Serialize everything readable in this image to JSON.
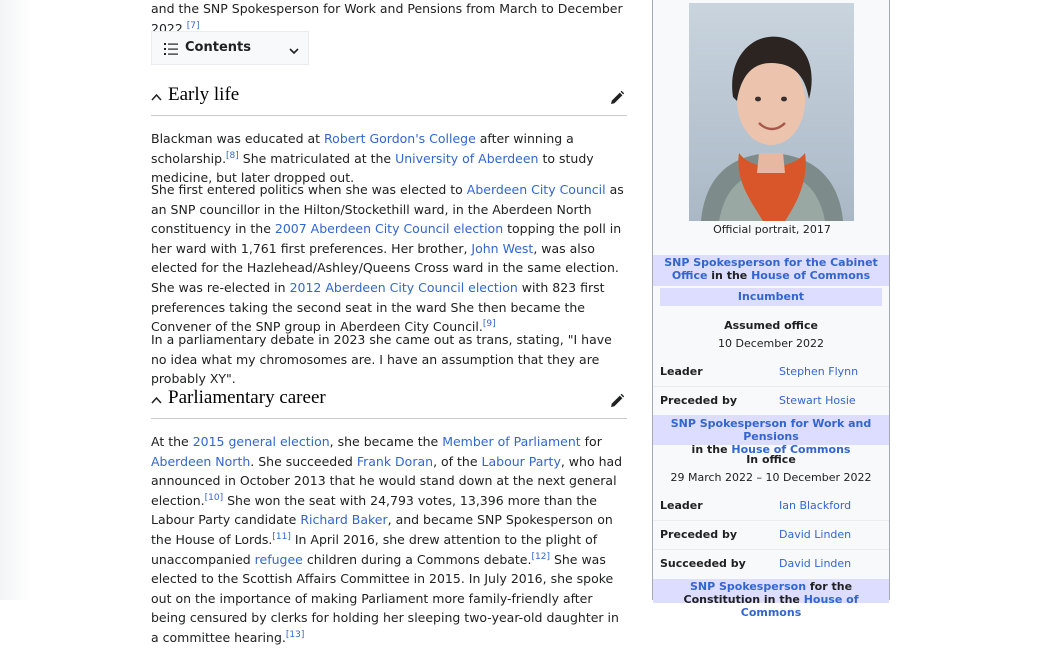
{
  "article": {
    "intro": {
      "text": "and the SNP Spokesperson for Work and Pensions from March to December 2022.",
      "ref": "[7]"
    },
    "toc": {
      "label": "Contents"
    },
    "early_life": {
      "heading": "Early life",
      "p1": {
        "t1": "Blackman was educated at ",
        "l1": "Robert Gordon's College",
        "t2": " after winning a scholarship.",
        "ref": "[8]",
        "t3": " She matriculated at the ",
        "l2": "University of Aberdeen",
        "t4": " to study medicine, but later dropped out."
      },
      "p2": {
        "t1": "She first entered politics when she was elected to ",
        "l1": "Aberdeen City Council",
        "t2": " as an SNP councillor in the Hilton/Stockethill ward, in the Aberdeen North constituency in the ",
        "l2": "2007 Aberdeen City Council election",
        "t3": " topping the poll in her ward with 1,761 first preferences. Her brother, ",
        "l3": "John West",
        "t4": ", was also elected for the Hazlehead/Ashley/Queens Cross ward in the same election. She was re-elected in ",
        "l4": "2012 Aberdeen City Council election",
        "t5": " with 823 first preferences taking the second seat in the ward She then became the Convener of the SNP group in Aberdeen City Council.",
        "ref": "[9]"
      },
      "p3": {
        "text": "In a parliamentary debate in 2023 she came out as trans, stating, \"I have no idea what my chromosomes are. I have an assumption that they are probably XY\"."
      }
    },
    "parliamentary": {
      "heading": "Parliamentary career",
      "p1": {
        "t1": "At the ",
        "l1": "2015 general election",
        "t2": ", she became the ",
        "l2": "Member of Parliament",
        "t3": " for ",
        "l3": "Aberdeen North",
        "t4": ". She succeeded ",
        "l4": "Frank Doran",
        "t5": ", of the ",
        "l5": "Labour Party",
        "t6": ", who had announced in October 2013 that he would stand down at the next general election.",
        "ref1": "[10]",
        "t7": " She won the seat with 24,793 votes, 13,396 more than the Labour Party candidate ",
        "l6": "Richard Baker",
        "t8": ", and became SNP Spokesperson on the House of Lords.",
        "ref2": "[11]",
        "t9": " In April 2016, she drew attention to the plight of unaccompanied ",
        "l7": "refugee",
        "t10": " children during a Commons debate.",
        "ref3": "[12]",
        "t11": " She was elected to the Scottish Affairs Committee in 2015. In July 2016, she spoke out on the importance of making Parliament more family-friendly after being censured by clerks for holding her sleeping two-year-old daughter in a committee hearing.",
        "ref4": "[13]"
      }
    }
  },
  "infobox": {
    "caption": "Official portrait, 2017",
    "office1": {
      "title_link": "SNP Spokesperson for the Cabinet Office",
      "in_text": " in the ",
      "house_link": "House of Commons",
      "incumbent": "Incumbent",
      "assumed_label": "Assumed office",
      "assumed_date": "10 December 2022",
      "rows": [
        {
          "label": "Leader",
          "value": "Stephen Flynn"
        },
        {
          "label": "Preceded by",
          "value": "Stewart Hosie"
        }
      ]
    },
    "office2": {
      "title_link": "SNP Spokesperson for Work and Pensions",
      "in_text": "in the ",
      "house_link": "House of Commons",
      "in_office_label": "In office",
      "in_office_dates": "29 March 2022 – 10 December 2022",
      "rows": [
        {
          "label": "Leader",
          "value": "Ian Blackford"
        },
        {
          "label": "Preceded by",
          "value": "David Linden"
        },
        {
          "label": "Succeeded by",
          "value": "David Linden"
        }
      ]
    },
    "office3": {
      "title_link": "SNP Spokesperson",
      "rest_text": " for the Constitution in the ",
      "house_link": "House of Commons"
    }
  }
}
